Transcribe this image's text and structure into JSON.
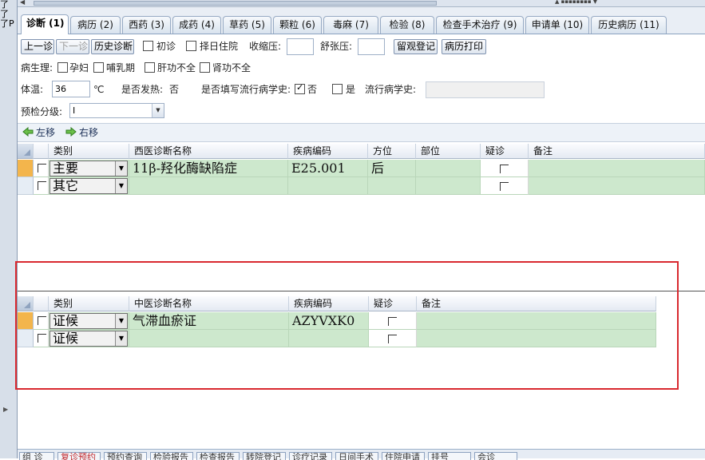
{
  "left_strip": {
    "glyphs": [
      "了",
      "了",
      "了P"
    ]
  },
  "tabs": [
    {
      "label": "诊断 (1)",
      "active": true
    },
    {
      "label": "病历 (2)"
    },
    {
      "label": "西药 (3)"
    },
    {
      "label": "成药 (4)"
    },
    {
      "label": "草药 (5)"
    },
    {
      "label": "颗粒 (6)"
    },
    {
      "label": "毒麻 (7)"
    },
    {
      "label": "检验 (8)"
    },
    {
      "label": "检查手术治疗 (9)"
    },
    {
      "label": "申请单 (10)"
    },
    {
      "label": "历史病历 (11)"
    }
  ],
  "toolbar": {
    "prev_label": "上一诊",
    "next_label": "下一诊",
    "history_label": "历史诊断",
    "first_visit_label": "初诊",
    "select_day_label": "择日住院",
    "systolic_label": "收缩压:",
    "systolic_value": "",
    "diastolic_label": "舒张压:",
    "diastolic_value": "",
    "observation_label": "留观登记",
    "print_label": "病历打印"
  },
  "physiology": {
    "label": "病生理:",
    "options": [
      "孕妇",
      "哺乳期",
      "肝功不全",
      "肾功不全"
    ]
  },
  "vitals": {
    "temp_label": "体温:",
    "temp_value": "36",
    "temp_unit": "℃",
    "fever_label": "是否发热:",
    "fever_value": "否",
    "epi_question": "是否填写流行病学史:",
    "no_label": "否",
    "no_checked": true,
    "yes_label": "是",
    "yes_checked": false,
    "epi_history_label": "流行病学史:",
    "epi_history_value": ""
  },
  "triage": {
    "label": "预检分级:",
    "value": "I"
  },
  "move": {
    "left_label": "左移",
    "right_label": "右移"
  },
  "western_grid": {
    "headers": [
      "类别",
      "西医诊断名称",
      "疾病编码",
      "方位",
      "部位",
      "疑诊",
      "备注"
    ],
    "rows": [
      {
        "category": "主要",
        "name": "11β-羟化酶缺陷症",
        "code": "E25.001",
        "side": "后",
        "part": "",
        "remark": ""
      },
      {
        "category": "其它",
        "name": "",
        "code": "",
        "side": "",
        "part": "",
        "remark": ""
      }
    ]
  },
  "tcm_grid": {
    "headers": [
      "类别",
      "中医诊断名称",
      "疾病编码",
      "疑诊",
      "备注"
    ],
    "rows": [
      {
        "category": "证候",
        "name": "气滞血瘀证",
        "code": "AZYVXK0",
        "remark": ""
      },
      {
        "category": "证候",
        "name": "",
        "code": "",
        "remark": ""
      }
    ]
  },
  "bottom_buttons": [
    "组 诊",
    "复诊预约",
    "预约查询",
    "检验报告",
    "检查报告",
    "转院登记",
    "诊疗记录",
    "日间手术",
    "住院申请",
    "挂号",
    "会诊"
  ],
  "colors": {
    "row_green": "#cde8cd",
    "highlight_red": "#d9292f",
    "current_row": "#f3b54c"
  }
}
